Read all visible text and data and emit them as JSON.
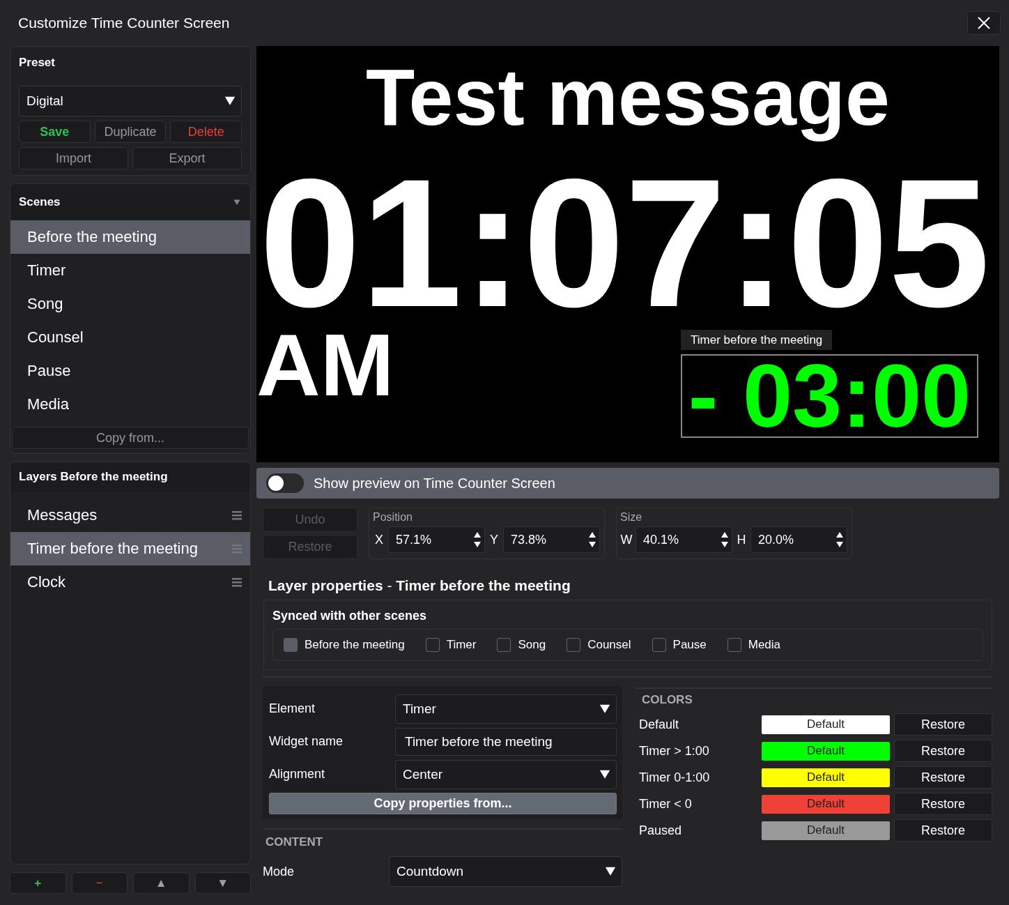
{
  "window": {
    "title": "Customize Time Counter Screen"
  },
  "preset": {
    "title": "Preset",
    "value": "Digital",
    "buttons": [
      {
        "label": "Save",
        "kind": "save"
      },
      {
        "label": "Duplicate",
        "kind": "plain"
      },
      {
        "label": "Delete",
        "kind": "delete"
      }
    ],
    "buttons_2": [
      {
        "label": "Import",
        "kind": "plain"
      },
      {
        "label": "Export",
        "kind": "plain"
      }
    ]
  },
  "scenes": {
    "title": "Scenes",
    "items": [
      {
        "label": "Before the meeting",
        "selected": true
      },
      {
        "label": "Timer",
        "selected": false
      },
      {
        "label": "Song",
        "selected": false
      },
      {
        "label": "Counsel",
        "selected": false
      },
      {
        "label": "Pause",
        "selected": false
      },
      {
        "label": "Media",
        "selected": false
      }
    ],
    "copy_button": "Copy from..."
  },
  "layers": {
    "title": "Layers Before the meeting",
    "items": [
      {
        "label": "Messages",
        "selected": false
      },
      {
        "label": "Timer before the meeting",
        "selected": true
      },
      {
        "label": "Clock",
        "selected": false
      }
    ]
  },
  "layer_buttons": [
    {
      "label": "+",
      "kind": "add"
    },
    {
      "label": "−",
      "kind": "remove"
    },
    {
      "label": "▲",
      "kind": "move"
    },
    {
      "label": "▼",
      "kind": "move"
    }
  ],
  "preview": {
    "message": "Test message",
    "clock": "01:07:05",
    "ampm": "AM",
    "timer_label": "Timer before the meeting",
    "timer_value": "- 03:00"
  },
  "preview_toggle": {
    "label": "Show preview on Time Counter Screen",
    "on": false
  },
  "history": [
    {
      "label": "Undo",
      "disabled": true
    },
    {
      "label": "Restore",
      "disabled": true
    }
  ],
  "position": {
    "title": "Position",
    "fields": [
      {
        "axis": "X",
        "value": "57.1%"
      },
      {
        "axis": "Y",
        "value": "73.8%"
      }
    ]
  },
  "size": {
    "title": "Size",
    "fields": [
      {
        "axis": "W",
        "value": "40.1%"
      },
      {
        "axis": "H",
        "value": "20.0%"
      }
    ]
  },
  "layer_properties": {
    "title": "Layer properties",
    "separator": "-",
    "name": "Timer before the meeting"
  },
  "synced": {
    "title": "Synced with other scenes",
    "scenes": [
      {
        "label": "Before the meeting",
        "checked": true
      },
      {
        "label": "Timer",
        "checked": false
      },
      {
        "label": "Song",
        "checked": false
      },
      {
        "label": "Counsel",
        "checked": false
      },
      {
        "label": "Pause",
        "checked": false
      },
      {
        "label": "Media",
        "checked": false
      }
    ]
  },
  "properties": [
    {
      "label": "Element",
      "value": "Timer",
      "kind": "dropdown"
    },
    {
      "label": "Widget name",
      "value": "Timer before the meeting",
      "kind": "text"
    },
    {
      "label": "Alignment",
      "value": "Center",
      "kind": "dropdown"
    }
  ],
  "copy_properties": "Copy properties from...",
  "content": {
    "heading": "CONTENT",
    "mode_label": "Mode",
    "mode": "Countdown"
  },
  "colors": {
    "heading": "COLORS",
    "rows": [
      {
        "label": "Default",
        "swatch": "Default",
        "color": "#ffffff",
        "restore": "Restore"
      },
      {
        "label": "Timer > 1:00",
        "swatch": "Default",
        "color": "#00ff00",
        "restore": "Restore"
      },
      {
        "label": "Timer 0-1:00",
        "swatch": "Default",
        "color": "#ffff00",
        "restore": "Restore"
      },
      {
        "label": "Timer < 0",
        "swatch": "Default",
        "color": "#ef4136",
        "restore": "Restore"
      },
      {
        "label": "Paused",
        "swatch": "Default",
        "color": "#999999",
        "restore": "Restore"
      }
    ]
  }
}
